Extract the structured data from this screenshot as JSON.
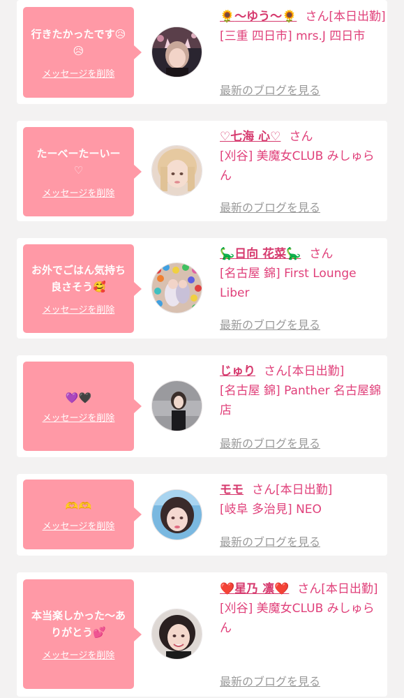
{
  "common": {
    "delete_label": "メッセージを削除",
    "blog_label": "最新のブログを見る",
    "san": "さん"
  },
  "items": [
    {
      "message": "行きたかったです😥😥",
      "name_prefix": "🌻",
      "name": "〜ゆう〜",
      "name_suffix": "🌻",
      "status": "[本日出勤]",
      "shop": "[三重 四日市] mrs.J 四日市",
      "avatar_icon": "girl-cat-ears-photo"
    },
    {
      "message": "たーべーたーいー",
      "message_extra": "♡",
      "name_prefix": "",
      "name": "♡七海 心♡",
      "name_suffix": "",
      "status": "",
      "shop": "[刈谷] 美魔女CLUB みしゅらん",
      "avatar_icon": "blonde-girl-photo"
    },
    {
      "message": "お外でごはん気持ち良さそう🥰",
      "name_prefix": "🦕",
      "name": "日向 花菜",
      "name_suffix": "🦕",
      "status": "",
      "shop": "[名古屋 錦] First Lounge Liber",
      "avatar_icon": "ball-pit-photo"
    },
    {
      "message": "💜🖤",
      "name_prefix": "",
      "name": "じゅり",
      "name_suffix": "",
      "status": "[本日出勤]",
      "shop": "[名古屋 錦] Panther 名古屋錦店",
      "avatar_icon": "panther-logo-photo"
    },
    {
      "message": "🫶🫶",
      "name_prefix": "",
      "name": "モモ",
      "name_suffix": "",
      "status": "[本日出勤]",
      "shop": "[岐阜 多治見] NEO",
      "avatar_icon": "girl-blue-light-photo"
    },
    {
      "message": "本当楽しかった〜ありがとう💕",
      "name_prefix": "❤️",
      "name": "星乃 凛",
      "name_suffix": "❤️",
      "status": "[本日出勤]",
      "shop": "[刈谷] 美魔女CLUB みしゅらん",
      "avatar_icon": "woman-smiling-photo"
    }
  ]
}
